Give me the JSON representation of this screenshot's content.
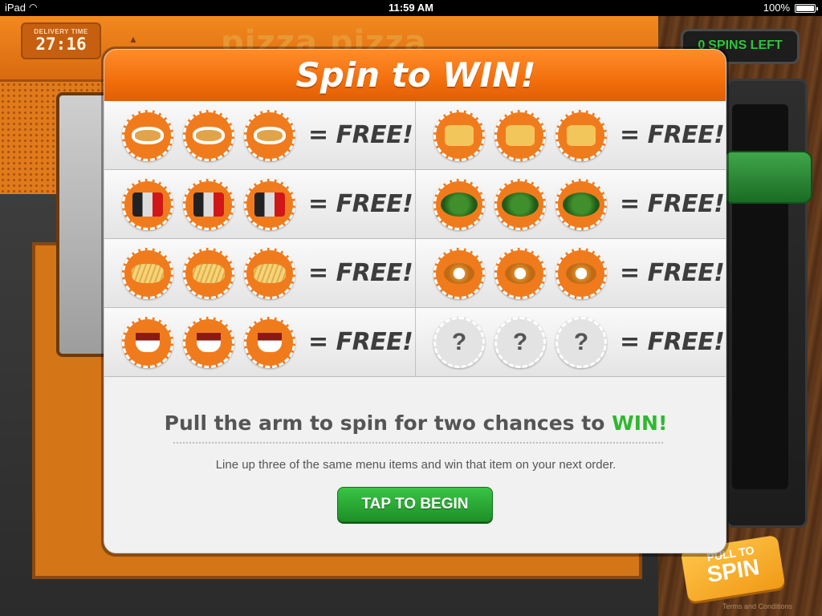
{
  "statusbar": {
    "device": "iPad",
    "time": "11:59 AM",
    "battery": "100%"
  },
  "game": {
    "delivery_label": "DELIVERY TIME",
    "delivery_time": "27:16",
    "brand": "pizza pizza",
    "spins_count": "0",
    "spins_label": "SPINS LEFT",
    "pull_line1": "PULL TO",
    "pull_line2": "SPIN",
    "terms": "Terms and Conditions"
  },
  "modal": {
    "title": "Spin to WIN!",
    "prizes": [
      {
        "item": "chicken-wings",
        "label": "= FREE!"
      },
      {
        "item": "nachos",
        "label": "= FREE!"
      },
      {
        "item": "cola-cans",
        "label": "= FREE!"
      },
      {
        "item": "salad",
        "label": "= FREE!"
      },
      {
        "item": "fries",
        "label": "= FREE!"
      },
      {
        "item": "onion-rings",
        "label": "= FREE!"
      },
      {
        "item": "dipping-sauce",
        "label": "= FREE!"
      },
      {
        "item": "mystery",
        "label": "= FREE!",
        "symbol": "?"
      }
    ],
    "headline_prefix": "Pull the arm to spin for two chances to",
    "headline_win": "WIN!",
    "subtext": "Line up three of the same menu items and win that item on your next order.",
    "button_label": "TAP TO BEGIN"
  },
  "colors": {
    "accent_orange": "#f26f0c",
    "win_green": "#2fb82f",
    "button_green": "#2aa836"
  }
}
